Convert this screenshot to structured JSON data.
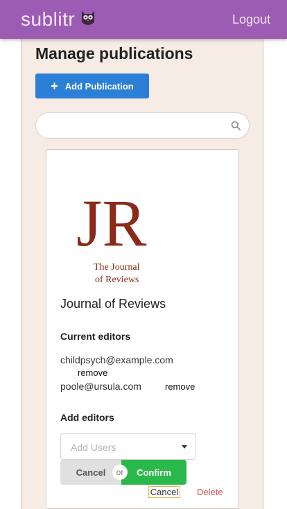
{
  "navbar": {
    "brand": "sublitr",
    "logout_label": "Logout",
    "brand_color": "#9d5cb3"
  },
  "page": {
    "title": "Manage publications",
    "add_button_label": "Add Publication",
    "add_button_icon": "plus-icon",
    "search": {
      "value": "",
      "placeholder": "",
      "icon": "search-icon"
    }
  },
  "publication": {
    "logo": {
      "letters": "JR",
      "line1": "The Journal",
      "line2": "of Reviews",
      "color": "#8b2a1a"
    },
    "name": "Journal of Reviews",
    "current_editors_heading": "Current editors",
    "editors": [
      {
        "email": "childpsych@example.com",
        "remove_label": "remove"
      },
      {
        "email": "poole@ursula.com",
        "remove_label": "remove"
      }
    ],
    "add_editors_heading": "Add editors",
    "add_users_placeholder": "Add Users",
    "cancel_button": "Cancel",
    "or_label": "or",
    "confirm_button": "Confirm",
    "cancel_link": "Cancel",
    "delete_link": "Delete"
  },
  "colors": {
    "primary_button": "#2b7fd6",
    "confirm": "#2bb84a",
    "delete": "#d9534f",
    "panel_bg": "#f7ebe5"
  }
}
